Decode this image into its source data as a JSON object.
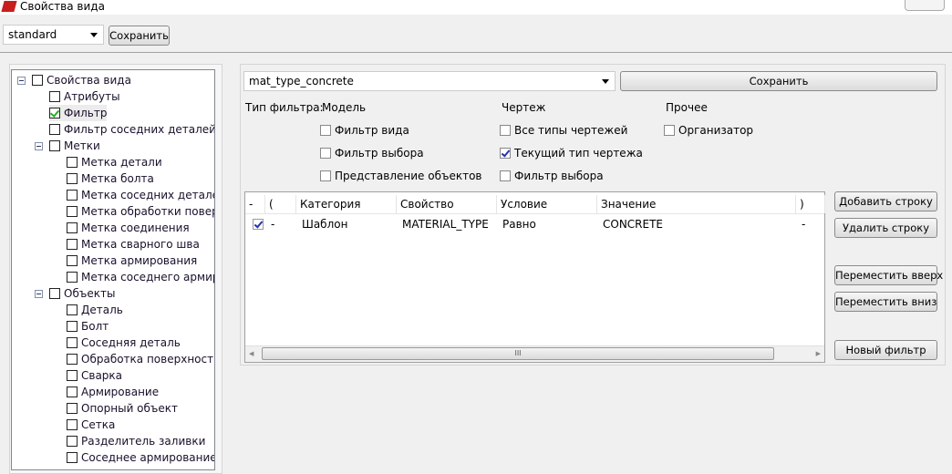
{
  "window": {
    "title": "Свойства вида"
  },
  "top": {
    "view_combo": "standard",
    "save_label": "Сохранить"
  },
  "tree": [
    {
      "label": "Свойства вида",
      "level": 0,
      "checked": false,
      "expander": true
    },
    {
      "label": "Атрибуты",
      "level": 1,
      "checked": false
    },
    {
      "label": "Фильтр",
      "level": 1,
      "checked": true,
      "selected": true
    },
    {
      "label": "Фильтр соседних деталей",
      "level": 1,
      "checked": false
    },
    {
      "label": "Метки",
      "level": 1,
      "checked": false,
      "expander": true
    },
    {
      "label": "Метка детали",
      "level": 2,
      "checked": false
    },
    {
      "label": "Метка болта",
      "level": 2,
      "checked": false
    },
    {
      "label": "Метка соседних деталей",
      "level": 2,
      "checked": false
    },
    {
      "label": "Метка обработки поверхн",
      "level": 2,
      "checked": false
    },
    {
      "label": "Метка соединения",
      "level": 2,
      "checked": false
    },
    {
      "label": "Метка сварного шва",
      "level": 2,
      "checked": false
    },
    {
      "label": "Метка армирования",
      "level": 2,
      "checked": false
    },
    {
      "label": "Метка соседнего армиров",
      "level": 2,
      "checked": false
    },
    {
      "label": "Объекты",
      "level": 1,
      "checked": false,
      "expander": true
    },
    {
      "label": "Деталь",
      "level": 2,
      "checked": false
    },
    {
      "label": "Болт",
      "level": 2,
      "checked": false
    },
    {
      "label": "Соседняя деталь",
      "level": 2,
      "checked": false
    },
    {
      "label": "Обработка поверхности",
      "level": 2,
      "checked": false
    },
    {
      "label": "Сварка",
      "level": 2,
      "checked": false
    },
    {
      "label": "Армирование",
      "level": 2,
      "checked": false
    },
    {
      "label": "Опорный объект",
      "level": 2,
      "checked": false
    },
    {
      "label": "Сетка",
      "level": 2,
      "checked": false
    },
    {
      "label": "Разделитель заливки",
      "level": 2,
      "checked": false
    },
    {
      "label": "Соседнее армирование",
      "level": 2,
      "checked": false
    }
  ],
  "filter": {
    "combo": "mat_type_concrete",
    "save_label": "Сохранить",
    "type_label": "Тип фильтра:",
    "groups": [
      {
        "title": "Модель",
        "items": [
          {
            "label": "Фильтр вида",
            "checked": false
          },
          {
            "label": "Фильтр выбора",
            "checked": false
          },
          {
            "label": "Представление объектов",
            "checked": false
          }
        ]
      },
      {
        "title": "Чертеж",
        "items": [
          {
            "label": "Все типы чертежей",
            "checked": false
          },
          {
            "label": "Текущий тип чертежа",
            "checked": true
          },
          {
            "label": "Фильтр выбора",
            "checked": false
          }
        ]
      },
      {
        "title": "Прочее",
        "items": [
          {
            "label": "Организатор",
            "checked": false
          }
        ]
      }
    ]
  },
  "table": {
    "headers": [
      "-",
      "(",
      "Категория",
      "Свойство",
      "Условие",
      "Значение",
      ")"
    ],
    "rows": [
      {
        "checked": true,
        "cells": [
          "-",
          "Шаблон",
          "MATERIAL_TYPE",
          "Равно",
          "CONCRETE",
          "-"
        ]
      }
    ],
    "scroll_grip": "III"
  },
  "buttons": {
    "add": "Добавить строку",
    "delete": "Удалить строку",
    "up": "Переместить вверх",
    "down": "Переместить вниз",
    "new": "Новый фильтр"
  }
}
